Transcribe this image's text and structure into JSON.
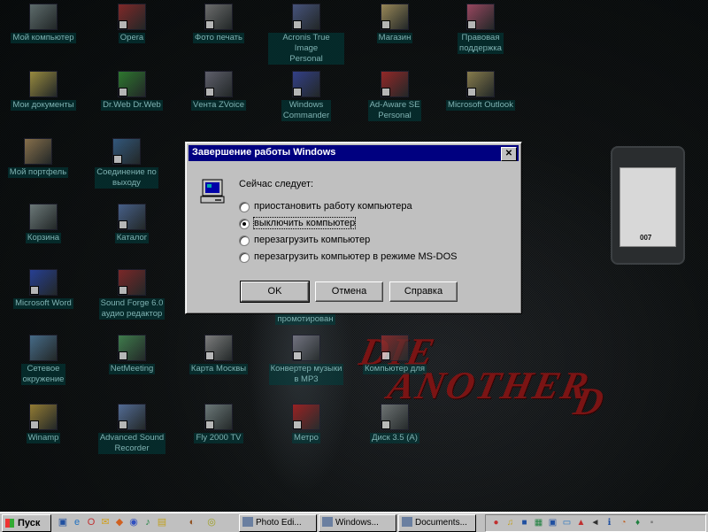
{
  "desktop": {
    "icons": [
      {
        "label": "Мой компьютер",
        "color": "#7a8c8c"
      },
      {
        "label": "Opera",
        "color": "#a83232"
      },
      {
        "label": "Фото печать",
        "color": "#8c8c8c"
      },
      {
        "label": "Acronis True Image\nPersonal",
        "color": "#5a6aa0"
      },
      {
        "label": "Магазин",
        "color": "#c8b070"
      },
      {
        "label": "Правовая\nподдержка",
        "color": "#c85a7a"
      },
      {
        "label": "Мои документы",
        "color": "#c8b450"
      },
      {
        "label": "Dr.Web Dr.Web",
        "color": "#3a9a3a"
      },
      {
        "label": "Vента ZVoice",
        "color": "#7a7a8a"
      },
      {
        "label": "Windows\nCommander",
        "color": "#4050b0"
      },
      {
        "label": "Ad-Aware SE\nPersonal",
        "color": "#c03030"
      },
      {
        "label": "Microsoft Outlook",
        "color": "#b0a060"
      },
      {
        "label": "Мой портфель",
        "color": "#b09060"
      },
      {
        "label": "Соединение по\nвыходу",
        "color": "#4070a0"
      },
      {
        "label": "Корзина",
        "color": "#8c9c9c"
      },
      {
        "label": "Каталог",
        "color": "#5a7ab0"
      },
      {
        "label": "Microsoft Word",
        "color": "#3050c0"
      },
      {
        "label": "Sound Forge 6.0\nаудио редактор",
        "color": "#a03030"
      },
      {
        "label": "Сетевое\nокружение",
        "color": "#5a8ab0"
      },
      {
        "label": "NetMeeting",
        "color": "#50a060"
      },
      {
        "label": "Карта Москвы",
        "color": "#a0a0a0"
      },
      {
        "label": "Конвертер музыки\nв MP3",
        "color": "#8a8a9a"
      },
      {
        "label": "Компьютер для",
        "color": "#a03030"
      },
      {
        "label": "Winamp",
        "color": "#c0a040"
      },
      {
        "label": "Advanced Sound\nRecorder",
        "color": "#6a8ac0"
      },
      {
        "label": "Fly 2000 TV",
        "color": "#8a9a9a"
      },
      {
        "label": "Метро",
        "color": "#c02020"
      },
      {
        "label": "Диск 3.5 (A)",
        "color": "#8a9090"
      }
    ],
    "extra_labels": [
      "промотирован"
    ],
    "wallpaper": {
      "line1": "DIE",
      "line2": "ANOTHER",
      "line3": "D",
      "watch_logo": "007"
    }
  },
  "dialog": {
    "title": "Завершение работы Windows",
    "close_glyph": "✕",
    "prompt": "Сейчас следует:",
    "options": [
      {
        "label": "приостановить работу компьютера",
        "checked": false
      },
      {
        "label": "выключить компьютер",
        "checked": true
      },
      {
        "label": "перезагрузить компьютер",
        "checked": false
      },
      {
        "label": "перезагрузить компьютер в режиме MS-DOS",
        "checked": false
      }
    ],
    "buttons": {
      "ok": "OK",
      "cancel": "Отмена",
      "help": "Справка"
    }
  },
  "taskbar": {
    "start_label": "Пуск",
    "quick_launch_icons": [
      "desktop-icon",
      "internet-explorer-icon",
      "outlook-icon",
      "channels-icon",
      "media-icon",
      "opera-icon",
      "winamp-icon",
      "folder-icon"
    ],
    "tasks": [
      {
        "label": "Photo Edi...",
        "icon": "photo-icon"
      },
      {
        "label": "Windows...",
        "icon": "folder-icon"
      },
      {
        "label": "Documents...",
        "icon": "document-icon"
      }
    ],
    "tray_icons": [
      "antivirus-icon",
      "sound-icon",
      "network-icon",
      "keyboard-icon",
      "lang-icon",
      "monitor-icon",
      "speaker-icon",
      "info-icon",
      "clock-icon"
    ],
    "colors": {
      "title_bar": "#000080",
      "face": "#c0c0c0"
    }
  }
}
